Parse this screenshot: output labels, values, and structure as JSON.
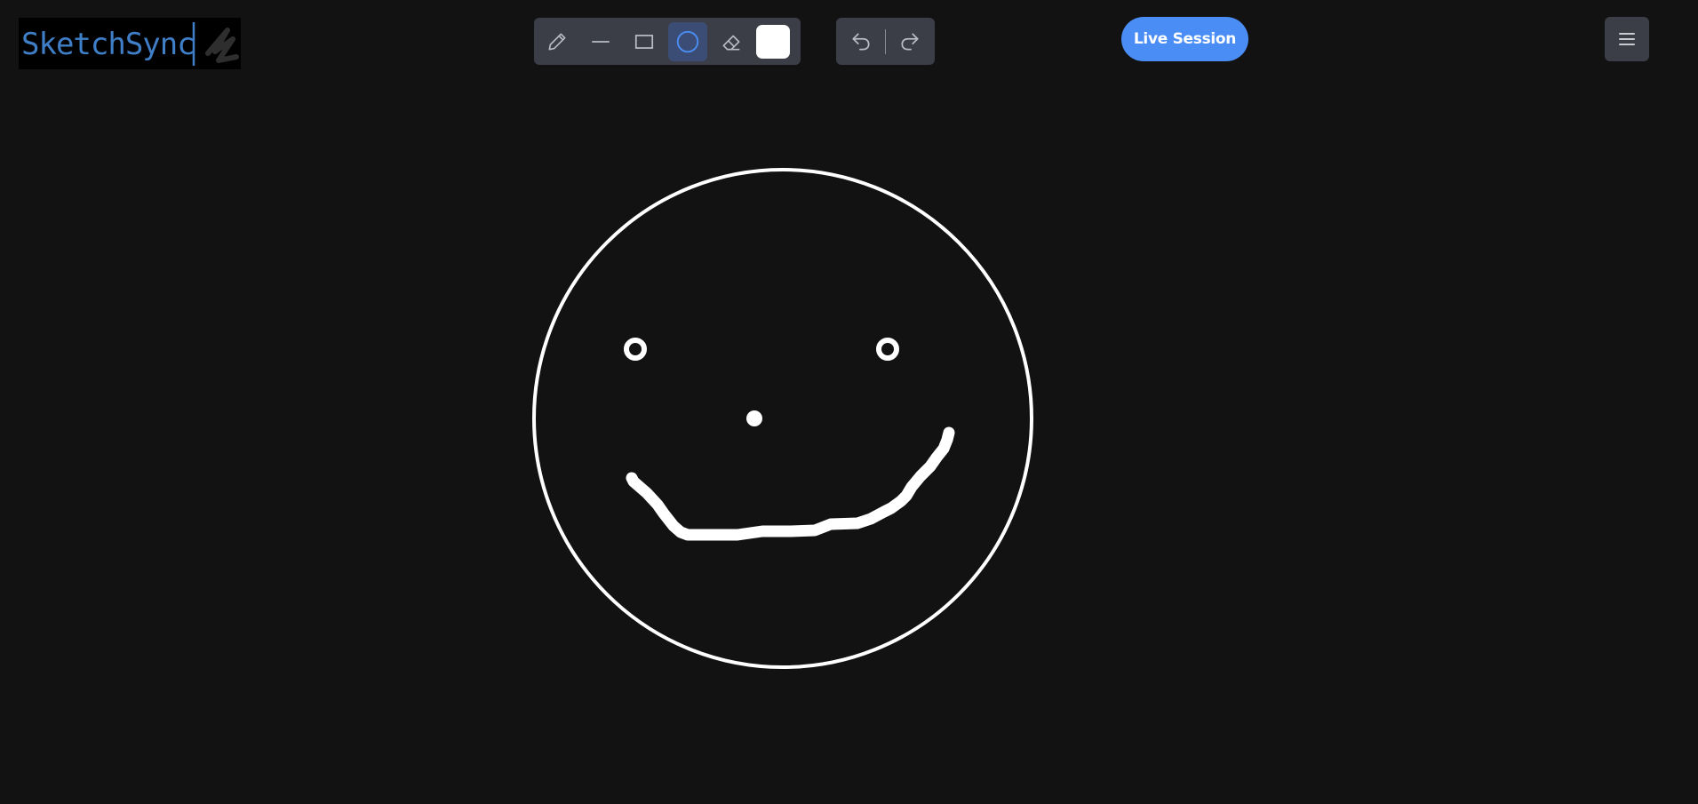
{
  "app": {
    "logo_text": "SketchSync",
    "logo_color": "#3f7fc8"
  },
  "toolbar": {
    "tools": [
      {
        "name": "pencil",
        "icon": "pencil-icon",
        "active": false
      },
      {
        "name": "line",
        "icon": "line-icon",
        "active": false
      },
      {
        "name": "rectangle",
        "icon": "rectangle-icon",
        "active": false
      },
      {
        "name": "circle",
        "icon": "circle-icon",
        "active": true
      },
      {
        "name": "eraser",
        "icon": "eraser-icon",
        "active": false
      }
    ],
    "stroke_color": "#ffffff",
    "undo_icon": "undo-icon",
    "redo_icon": "redo-icon"
  },
  "header": {
    "live_session_label": "Live Session",
    "live_session_color": "#4a8ef5",
    "menu_icon": "hamburger-menu-icon"
  },
  "colors": {
    "background": "#121212",
    "toolbar_bg": "#3b3d47",
    "active_tool_bg": "#3b4d75",
    "accent": "#4a8ef5",
    "icon_color": "#b9bcc6"
  }
}
